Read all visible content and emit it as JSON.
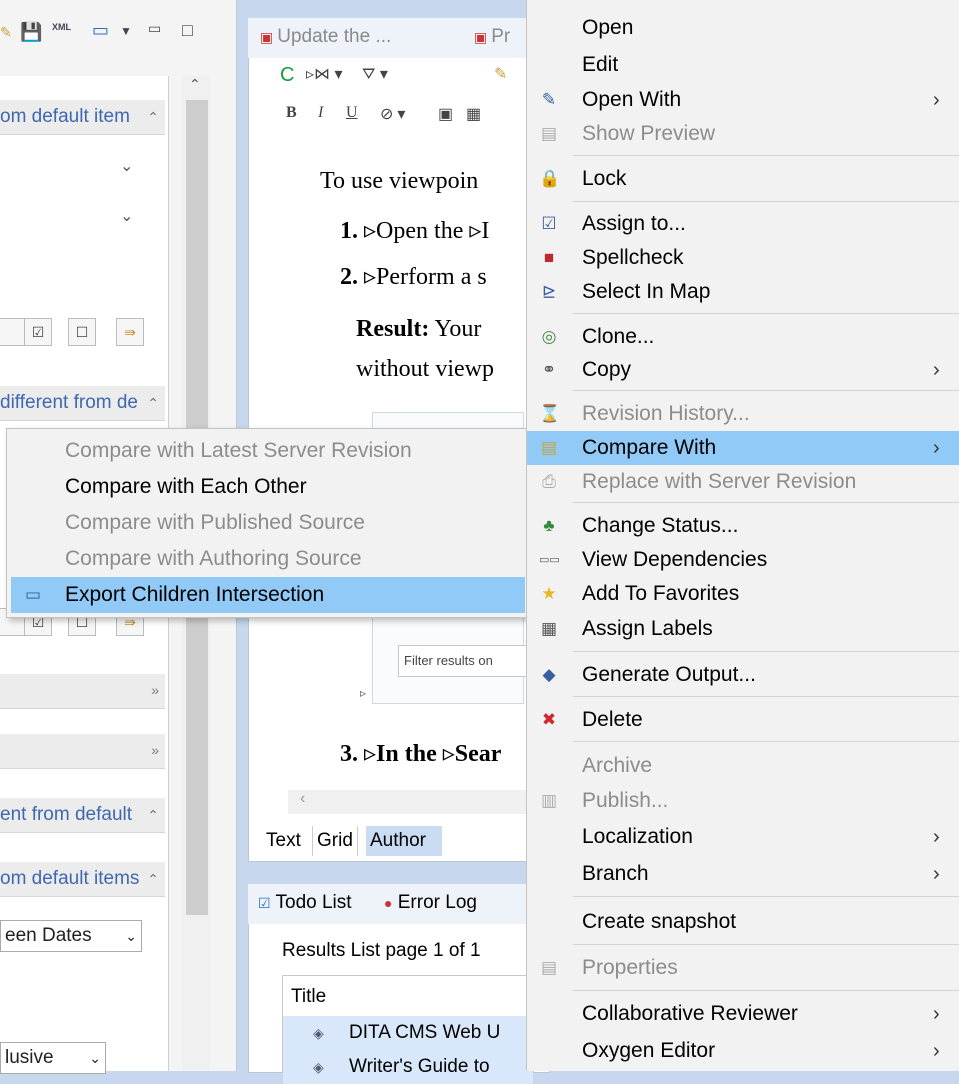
{
  "colors": {
    "menu_bg": "#f2f2f2",
    "highlight": "#91c9f7",
    "link_blue": "#3f67b0",
    "disabled_text": "#8c8c8c"
  },
  "left_panel": {
    "sections": [
      "om default item",
      "different from de",
      "ent from default",
      "om default items"
    ],
    "date_field": "een Dates",
    "inclusive_field": "lusive"
  },
  "editor": {
    "tabs": [
      "Update the ...",
      "Pr"
    ],
    "paragraphs": {
      "intro": "To use viewpoin",
      "step1_num": "1.",
      "step1_text": "▹Open the ▹I",
      "step2_num": "2.",
      "step2_text": "▹Perform a s",
      "result_label": "Result:",
      "result_text": " Your",
      "result_line2": "without viewp",
      "step3_num": "3.",
      "step3_text": "▹In the ▹Sear"
    },
    "filter_placeholder": "Filter results on",
    "mode_tabs": [
      "Text",
      "Grid",
      "Author"
    ]
  },
  "bottom_view": {
    "tabs": [
      "Todo List",
      "Error Log"
    ],
    "results_label": "Results List page 1 of 1",
    "table_header": "Title",
    "rows": [
      "DITA CMS Web U",
      "Writer's Guide to"
    ]
  },
  "submenu": {
    "items": [
      {
        "label": "Compare with Latest Server Revision",
        "enabled": false
      },
      {
        "label": "Compare with Each Other",
        "enabled": true
      },
      {
        "label": "Compare with Published Source",
        "enabled": false
      },
      {
        "label": "Compare with Authoring Source",
        "enabled": false
      },
      {
        "label": "Export Children Intersection",
        "enabled": true,
        "highlighted": true
      }
    ]
  },
  "context_menu": {
    "items": [
      {
        "label": "Open"
      },
      {
        "label": "Edit"
      },
      {
        "label": "Open With"
      },
      {
        "label": "Show Preview"
      },
      {
        "label": "Lock"
      },
      {
        "label": "Assign to..."
      },
      {
        "label": "Spellcheck"
      },
      {
        "label": "Select In Map"
      },
      {
        "label": "Clone..."
      },
      {
        "label": "Copy"
      },
      {
        "label": "Revision History..."
      },
      {
        "label": "Compare With"
      },
      {
        "label": "Replace with Server Revision"
      },
      {
        "label": "Change Status..."
      },
      {
        "label": "View Dependencies"
      },
      {
        "label": "Add To Favorites"
      },
      {
        "label": "Assign Labels"
      },
      {
        "label": "Generate Output..."
      },
      {
        "label": "Delete"
      },
      {
        "label": "Archive"
      },
      {
        "label": "Publish..."
      },
      {
        "label": "Localization"
      },
      {
        "label": "Branch"
      },
      {
        "label": "Create snapshot"
      },
      {
        "label": "Properties"
      },
      {
        "label": "Collaborative Reviewer"
      },
      {
        "label": "Oxygen Editor"
      }
    ]
  }
}
